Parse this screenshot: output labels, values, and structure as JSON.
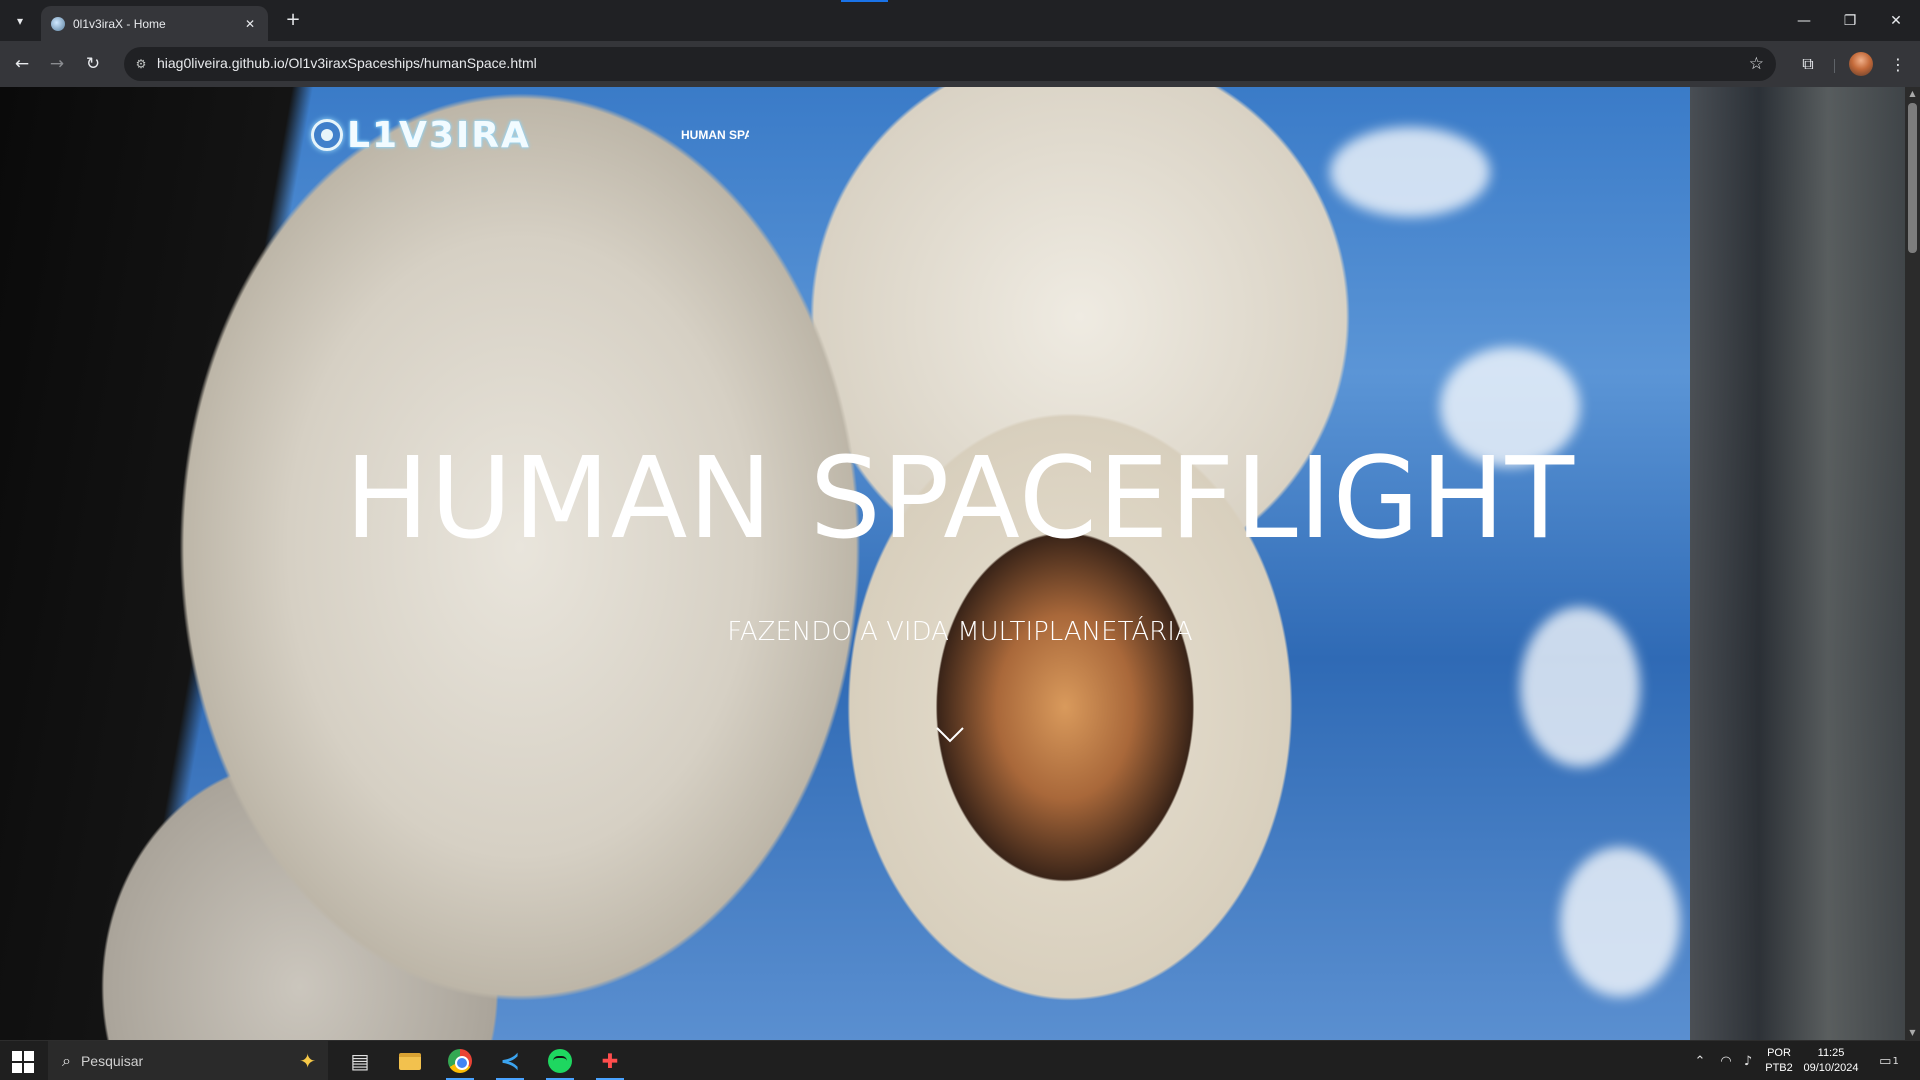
{
  "browser": {
    "tab_title": "0l1v3iraX - Home",
    "url": "hiag0liveira.github.io/Ol1v3iraxSpaceships/humanSpace.html"
  },
  "page": {
    "logo_text": "L1V3IRA",
    "nav_link": "HUMAN SPACEFLIGHT",
    "hero_title": "HUMAN SPACEFLIGHT",
    "hero_subtitle": "FAZENDO A VIDA MULTIPLANETÁRIA"
  },
  "taskbar": {
    "search_placeholder": "Pesquisar",
    "language_line1": "POR",
    "language_line2": "PTB2",
    "time": "11:25",
    "date": "09/10/2024",
    "notification_count": "1"
  },
  "colors": {
    "chrome_dark": "#202124",
    "chrome_toolbar": "#35363a",
    "taskbar": "#1f1f1f",
    "accent": "#1a73e8"
  }
}
